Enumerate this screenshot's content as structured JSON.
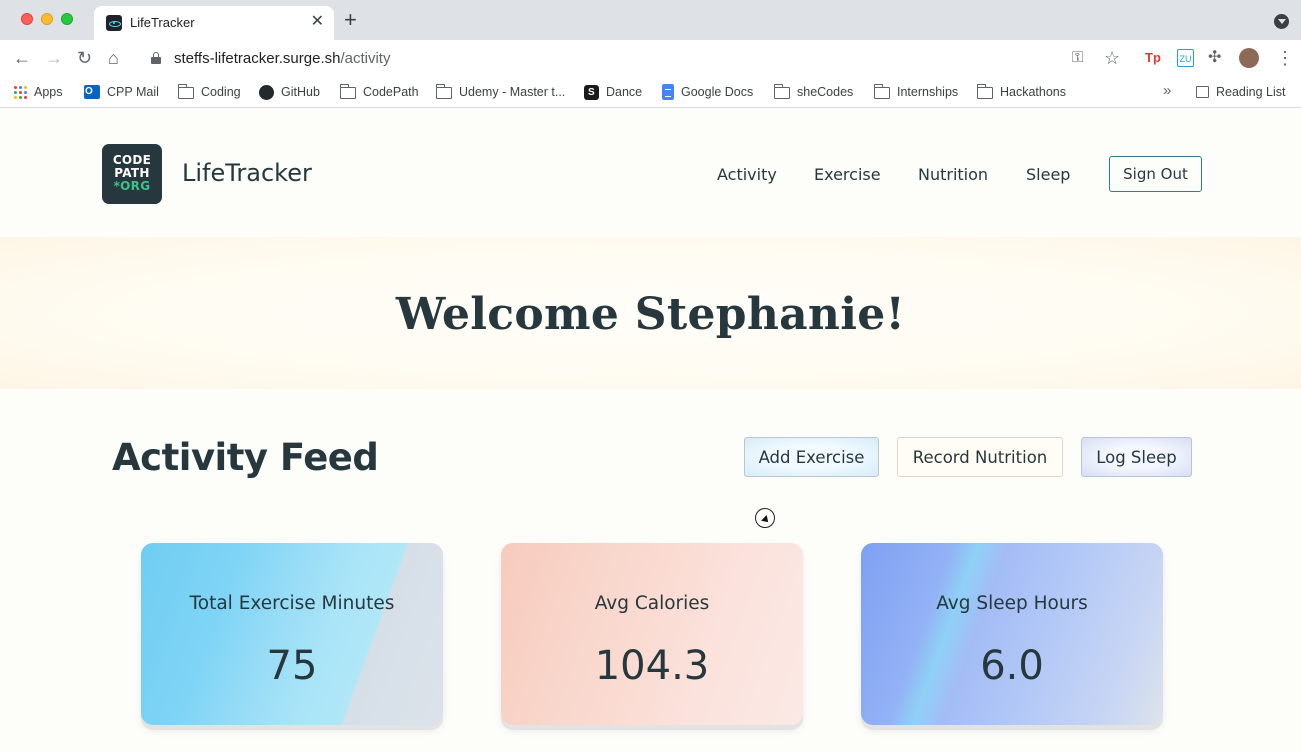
{
  "browser": {
    "tab_title": "LifeTracker",
    "new_tab_symbol": "+",
    "tab_close_symbol": "✕",
    "url_host": "steffs-lifetracker.surge.sh",
    "url_path": "/activity",
    "bookmarks": [
      {
        "label": "Apps",
        "icon": "apps-grid-icon"
      },
      {
        "label": "CPP Mail",
        "icon": "outlook-icon"
      },
      {
        "label": "Coding",
        "icon": "folder-icon"
      },
      {
        "label": "GitHub",
        "icon": "github-icon"
      },
      {
        "label": "CodePath",
        "icon": "folder-icon"
      },
      {
        "label": "Udemy - Master t...",
        "icon": "folder-icon"
      },
      {
        "label": "Dance",
        "icon": "s-app-icon"
      },
      {
        "label": "Google Docs",
        "icon": "google-docs-icon"
      },
      {
        "label": "sheCodes",
        "icon": "folder-icon"
      },
      {
        "label": "Internships",
        "icon": "folder-icon"
      },
      {
        "label": "Hackathons",
        "icon": "folder-icon"
      }
    ],
    "bookmarks_more": "»",
    "reading_list": "Reading List"
  },
  "navbar": {
    "logo_line1": "CODE",
    "logo_line2": "PATH",
    "logo_line3": "*ORG",
    "brand": "LifeTracker",
    "links": [
      "Activity",
      "Exercise",
      "Nutrition",
      "Sleep"
    ],
    "sign_out": "Sign Out"
  },
  "hero": {
    "welcome": "Welcome Stephanie!"
  },
  "feed": {
    "title": "Activity Feed",
    "buttons": {
      "add_exercise": "Add Exercise",
      "record_nutrition": "Record Nutrition",
      "log_sleep": "Log Sleep"
    },
    "cards": [
      {
        "title": "Total Exercise Minutes",
        "value": "75"
      },
      {
        "title": "Avg Calories",
        "value": "104.3"
      },
      {
        "title": "Avg Sleep Hours",
        "value": "6.0"
      }
    ]
  },
  "colors": {
    "primary_text": "#26383e",
    "logo_green": "#3ec28a",
    "signout_border": "#2f7d85"
  }
}
